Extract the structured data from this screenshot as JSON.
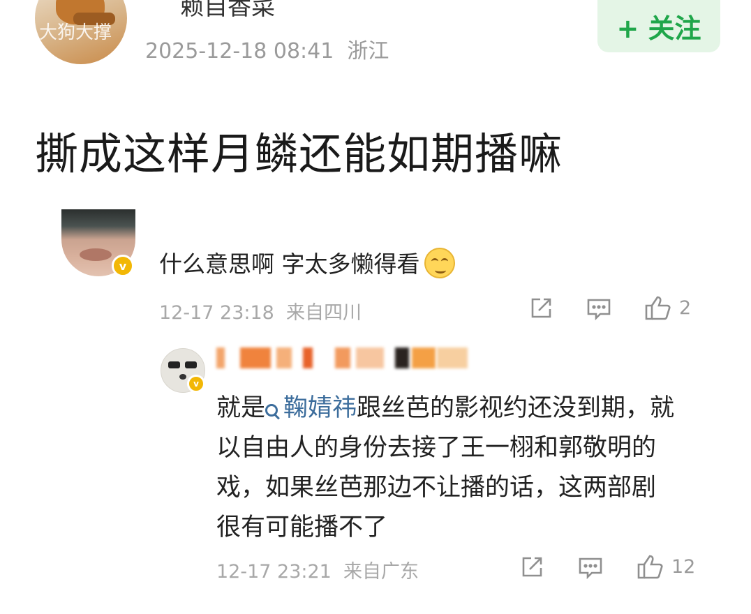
{
  "post": {
    "username": "赖自香菜",
    "timestamp": "2025-12-18 08:41",
    "location": "浙江",
    "follow_label": "+ 关注",
    "avatar_watermark": "大狗大撑",
    "title": "撕成这样月鳞还能如期播嘛"
  },
  "comments": [
    {
      "text": "什么意思啊 字太多懒得看",
      "emoji": "smile-emoji",
      "time": "12-17 23:18",
      "location": "来自四川",
      "likes": "2"
    },
    {
      "text_before": "就是",
      "topic": "鞠婧祎",
      "text_after": "跟丝芭的影视约还没到期，就以自由人的身份去接了王一栩和郭敬明的戏，如果丝芭那边不让播的话，这两部剧很有可能播不了",
      "time": "12-17 23:21",
      "location": "来自广东",
      "likes": "12"
    }
  ],
  "colors": {
    "follow_green": "#1fa64a",
    "follow_bg": "#e4f5e6",
    "topic_blue": "#3c6d9c",
    "verified_badge": "#f2b705",
    "meta_gray": "#9a9a9a"
  },
  "icons": [
    "share-icon",
    "comment-icon",
    "like-icon",
    "topic-search-icon",
    "verified-badge-icon"
  ]
}
